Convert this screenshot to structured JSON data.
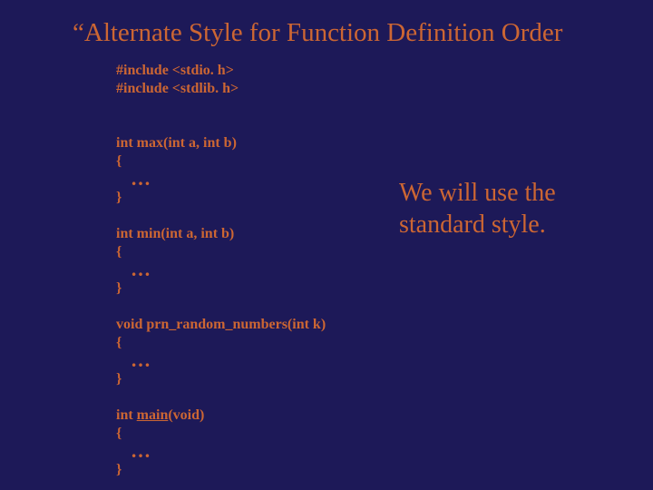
{
  "title": "“Alternate Style for Function Definition Order",
  "code": {
    "inc1": "#include <stdio. h>",
    "inc2": "#include <stdlib. h>",
    "max_sig": "int max(int a, int b)",
    "min_sig": "int min(int a, int b)",
    "prn_sig": "void prn_random_numbers(int k)",
    "main_pre": "int ",
    "main_name": "main",
    "main_post": "(void)",
    "open": "{",
    "close": "}",
    "ellipsis": "…"
  },
  "note_line1": "We will use the",
  "note_line2": "standard style."
}
